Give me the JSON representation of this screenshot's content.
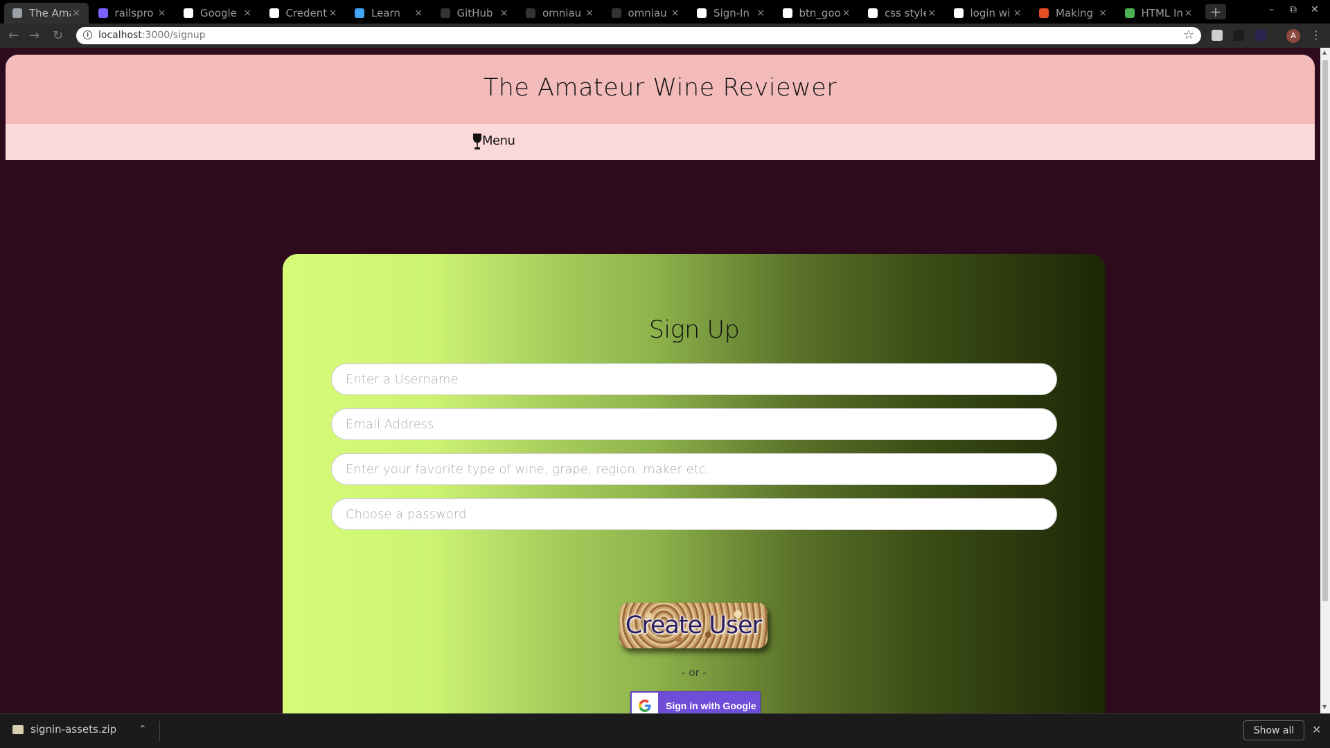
{
  "browser": {
    "tabs": [
      {
        "title": "The Ama",
        "favicon_color": "#9aa0a6",
        "active": true
      },
      {
        "title": "railspro",
        "favicon_color": "#7b61ff"
      },
      {
        "title": "Google",
        "favicon_color": "#ffffff"
      },
      {
        "title": "Credent",
        "favicon_color": "#ffffff"
      },
      {
        "title": "Learn",
        "favicon_color": "#42a5f5"
      },
      {
        "title": "GitHub",
        "favicon_color": "#333333"
      },
      {
        "title": "omniau",
        "favicon_color": "#333333"
      },
      {
        "title": "omniau",
        "favicon_color": "#333333"
      },
      {
        "title": "Sign-In",
        "favicon_color": "#ffffff"
      },
      {
        "title": "btn_goo",
        "favicon_color": "#ffffff"
      },
      {
        "title": "css style",
        "favicon_color": "#ffffff"
      },
      {
        "title": "login wi",
        "favicon_color": "#ffffff"
      },
      {
        "title": "Making",
        "favicon_color": "#e44d26"
      },
      {
        "title": "HTML In",
        "favicon_color": "#4caf50"
      }
    ],
    "url_host": "localhost",
    "url_path": ":3000/signup",
    "new_tab_glyph": "+",
    "close_glyph": "×"
  },
  "site": {
    "title": "The Amateur Wine Reviewer",
    "menu_label": "Menu",
    "menu_icon": "wine-glass-icon"
  },
  "signup": {
    "heading": "Sign Up",
    "username_placeholder": "Enter a Username",
    "email_placeholder": "Email Address",
    "favorite_placeholder": "Enter your favorite type of wine, grape, region, maker etc.",
    "password_placeholder": "Choose a password",
    "create_button": "Create User",
    "or_text": "- or -",
    "google_button": "Sign in with Google"
  },
  "downloads": {
    "file_name": "signin-assets.zip",
    "show_all": "Show all"
  },
  "colors": {
    "page_bg": "#2d0a1c",
    "header_bg": "#f3bcbb",
    "menubar_bg": "#fbd9d8",
    "card_gradient_start": "#d5fb78",
    "card_gradient_end": "#1d2606",
    "google_button_bg": "#6f4dd8"
  }
}
